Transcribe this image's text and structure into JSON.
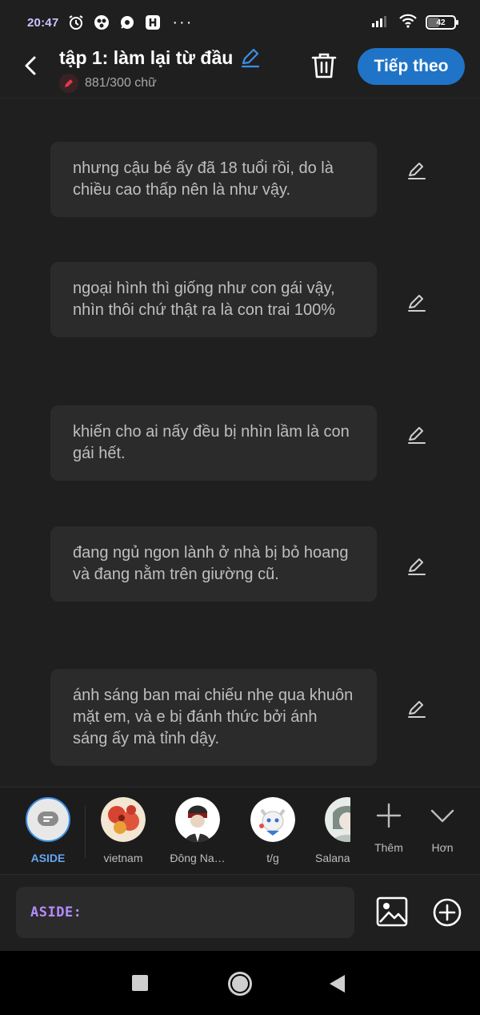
{
  "status_bar": {
    "time": "20:47",
    "battery": "42",
    "icons": [
      "alarm-icon",
      "app-icon",
      "chat-icon",
      "h-app-icon",
      "signal-icon",
      "wifi-icon",
      "battery-icon"
    ]
  },
  "header": {
    "title": "tập 1: làm lại từ đầu",
    "word_count": "881/300 chữ",
    "next_label": "Tiếp theo"
  },
  "messages": [
    {
      "text": "nhưng cậu bé ấy đã 18 tuổi rồi, do là chiều cao thấp nên là như vậy."
    },
    {
      "text": "ngoại hình thì giống như con gái vậy, nhìn thôi chứ thật ra là con trai 100%"
    },
    {
      "text": "khiến cho ai nấy đều bị nhìn lầm là con gái hết."
    },
    {
      "text": "đang ngủ ngon lành ở nhà bị bỏ hoang và đang nằm trên giường cũ."
    },
    {
      "text": "ánh sáng ban mai chiếu nhẹ qua khuôn mặt em, và e bị đánh thức bởi ánh sáng ấy mà tỉnh dậy."
    }
  ],
  "characters": [
    {
      "name": "ASIDE",
      "selected": true
    },
    {
      "name": "vietnam"
    },
    {
      "name": "Đông Na…"
    },
    {
      "name": "t/g"
    },
    {
      "name": "Salana"
    }
  ],
  "tools": {
    "more_label": "Thêm",
    "less_label": "Hơn"
  },
  "input": {
    "prefix": "ASIDE:"
  },
  "colors": {
    "accent": "#1f74c7",
    "aside_blue": "#64a6f1",
    "prefix_purple": "#b48cff",
    "background": "#1f1f1f",
    "bubble": "#2b2b2b"
  }
}
